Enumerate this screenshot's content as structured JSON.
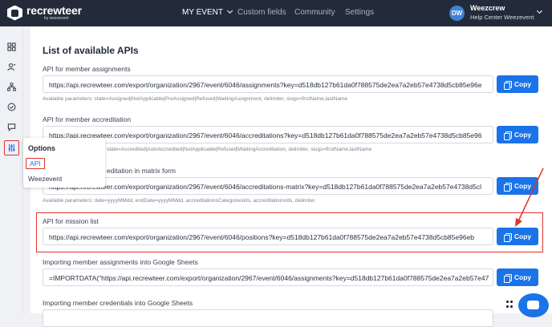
{
  "brand": {
    "name": "recrewteer",
    "sub": "by weezevent"
  },
  "nav": {
    "items": [
      {
        "label": "MY EVENT"
      },
      {
        "label": "Custom fields"
      },
      {
        "label": "Community"
      },
      {
        "label": "Settings"
      }
    ]
  },
  "user": {
    "initials": "DW",
    "name": "Weezcrew",
    "org": "Help Center Weezevent"
  },
  "sidebar": {
    "icons": [
      "dashboard-icon",
      "members-icon",
      "organization-icon",
      "check-icon",
      "chat-icon",
      "settings-sliders-icon"
    ]
  },
  "popover": {
    "title": "Options",
    "items": [
      {
        "label": "API"
      },
      {
        "label": "Weezevent"
      }
    ]
  },
  "main": {
    "title": "List of available APIs",
    "copy_label": "Copy",
    "apis": [
      {
        "label": "API for member assignments",
        "url": "https://api.recrewteer.com/export/organization/2967/event/6046/assignments?key=d518db127b61da0f788575de2ea7a2eb57e4738d5cb85e96e",
        "params": "Available parameters: state=Assigned|NotApplicable|PreAssigned|Refused|WaitingAssignment, delimiter, slugs=firstName,lastName"
      },
      {
        "label": "API for member accreditation",
        "url": "https://api.recrewteer.com/export/organization/2967/event/6046/accreditations?key=d518db127b61da0f788575de2ea7a2eb57e4738d5cb85e96",
        "params": "state=Accredited|AutoAccredited|NotApplicable|Refused|WaitingAccreditation, delimiter, slugs=firstName,lastName"
      },
      {
        "label": "editation in matrix form",
        "url": "https://api.recrewteer.com/export/organization/2967/event/6046/accreditations-matrix?key=d518db127b61da0f788575de2ea7a2eb57e4738d5cl",
        "params": "Available parameters: date=yyyyMMdd, endDate=yyyyMMdd, accreditationsCategoriesIds, accreditationsIds, delimiter"
      },
      {
        "label": "API for mission list",
        "url": "https://api.recrewteer.com/export/organization/2967/event/6046/positions?key=d518db127b61da0f788575de2ea7a2eb57e4738d5cb85e96eb",
        "params": ""
      },
      {
        "label": "Importing member assignments into Google Sheets",
        "url": "=IMPORTDATA(\"https://api.recrewteer.com/export/organization/2967/event/6046/assignments?key=d518db127b61da0f788575de2ea7a2eb57e47",
        "params": ""
      },
      {
        "label": "Importing member credentials into Google Sheets",
        "url": "",
        "params": ""
      }
    ]
  },
  "colors": {
    "accent": "#1a73e8",
    "topbar": "#232b3b",
    "highlight": "#e0322b"
  }
}
